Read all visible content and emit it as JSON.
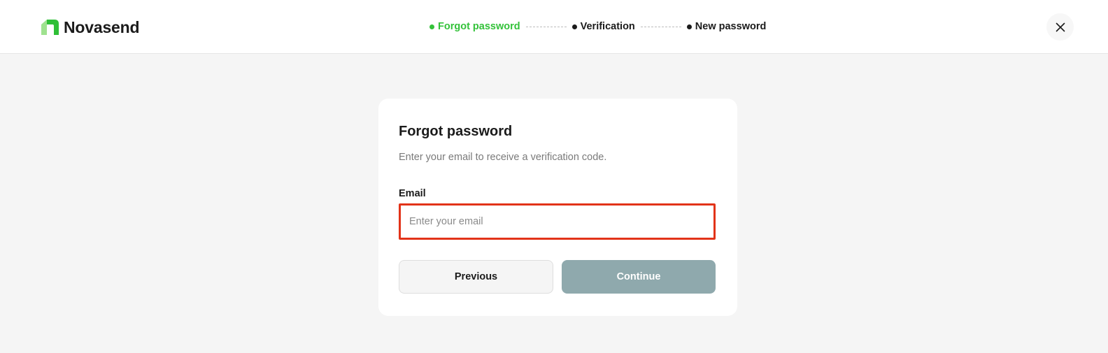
{
  "header": {
    "brand_name": "Novasend",
    "steps": [
      {
        "label": "Forgot password",
        "active": true
      },
      {
        "label": "Verification",
        "active": false
      },
      {
        "label": "New password",
        "active": false
      }
    ],
    "close_icon": "close-icon"
  },
  "card": {
    "title": "Forgot password",
    "subtitle": "Enter your email to receive a verification code.",
    "email_label": "Email",
    "email_value": "",
    "email_placeholder": "Enter your email",
    "previous_label": "Previous",
    "continue_label": "Continue"
  },
  "colors": {
    "accent_green": "#34c23a",
    "highlight_red": "#e23319",
    "continue_disabled": "#8fa9ad",
    "background": "#f5f5f5"
  }
}
